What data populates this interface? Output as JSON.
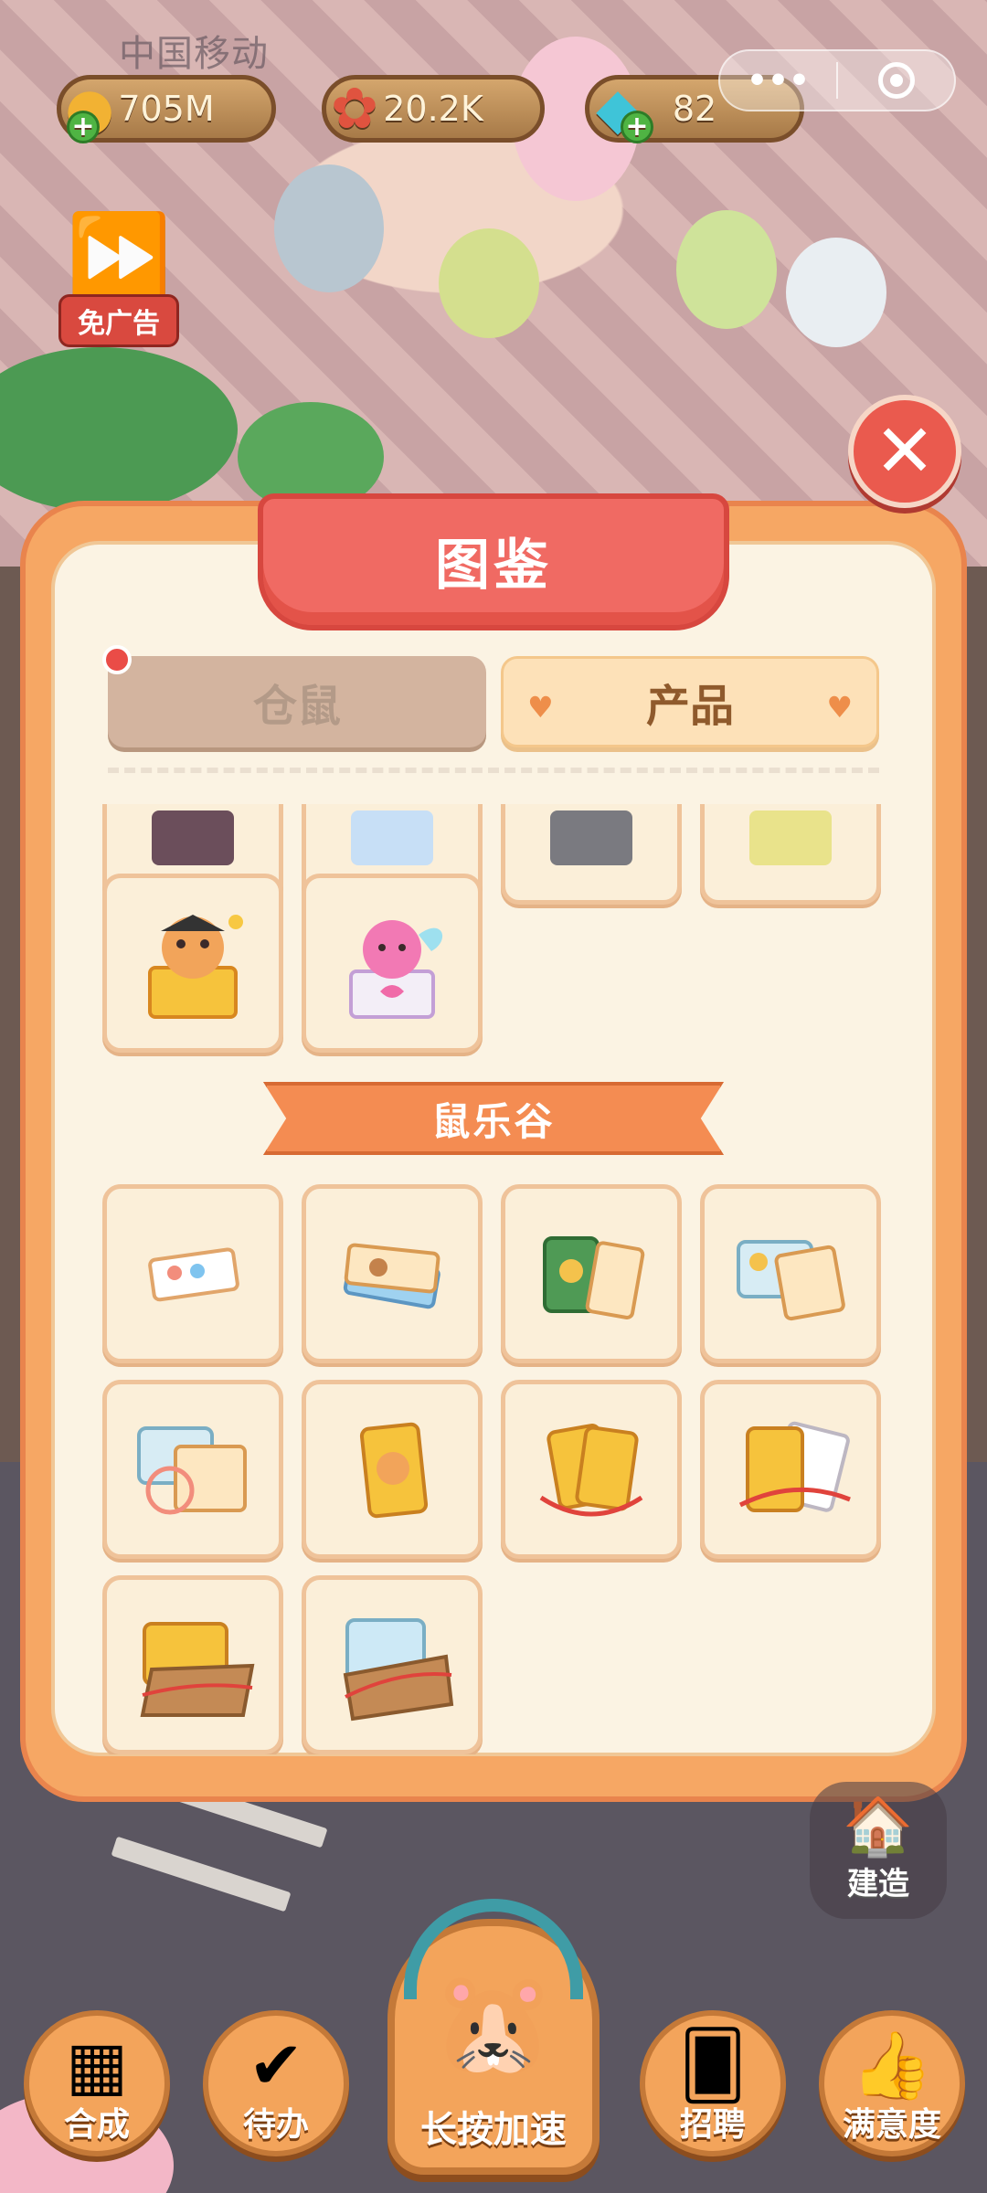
{
  "status_bar": {
    "carrier": "中国移动"
  },
  "resources": [
    {
      "name": "coin",
      "icon": "coin-icon",
      "value": "705M",
      "color": "#f2b233"
    },
    {
      "name": "flower",
      "icon": "flower-icon",
      "value": "20.2K",
      "color": "#e0533f"
    },
    {
      "name": "gem",
      "icon": "diamond-icon",
      "value": "82",
      "color": "#3fc4d8"
    }
  ],
  "ad_button": {
    "label": "免广告"
  },
  "panel": {
    "title": "图鉴",
    "tabs": [
      {
        "label": "仓鼠",
        "active": false,
        "has_dot": true
      },
      {
        "label": "产品",
        "active": true
      }
    ],
    "section_title": "鼠乐谷"
  },
  "build": {
    "label": "建造"
  },
  "bottom_nav": {
    "merge": "合成",
    "todo": "待办",
    "speed": "长按加速",
    "recruit": "招聘",
    "satisfaction": "满意度"
  },
  "colors": {
    "panel": "#f6a764",
    "title": "#f06a63",
    "accent": "#f48c52"
  }
}
